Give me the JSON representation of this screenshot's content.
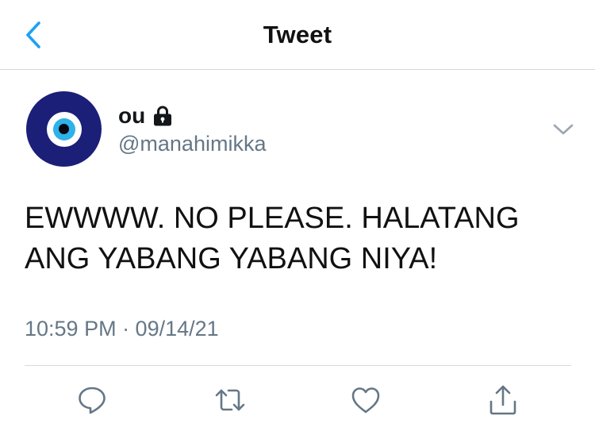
{
  "colors": {
    "accent": "#1da1f2",
    "icon_gray": "#657786",
    "avatar_navy": "#1b1f78",
    "eye_blue": "#2fb1ea"
  },
  "header": {
    "title": "Tweet",
    "back_icon": "chevron-left-icon"
  },
  "tweet": {
    "author": {
      "display_name": "ou",
      "protected_icon": "lock-icon",
      "handle": "@manahimikka",
      "avatar": "evil-eye-avatar"
    },
    "menu_icon": "chevron-down-icon",
    "text_lines": [
      "EWWWW. NO PLEASE. HALATANG",
      "ANG YABANG YABANG NIYA!"
    ],
    "timestamp": "10:59 PM · 09/14/21"
  },
  "actions": [
    {
      "name": "reply",
      "icon": "comment-icon"
    },
    {
      "name": "retweet",
      "icon": "retweet-icon"
    },
    {
      "name": "like",
      "icon": "heart-icon"
    },
    {
      "name": "share",
      "icon": "share-icon"
    }
  ]
}
